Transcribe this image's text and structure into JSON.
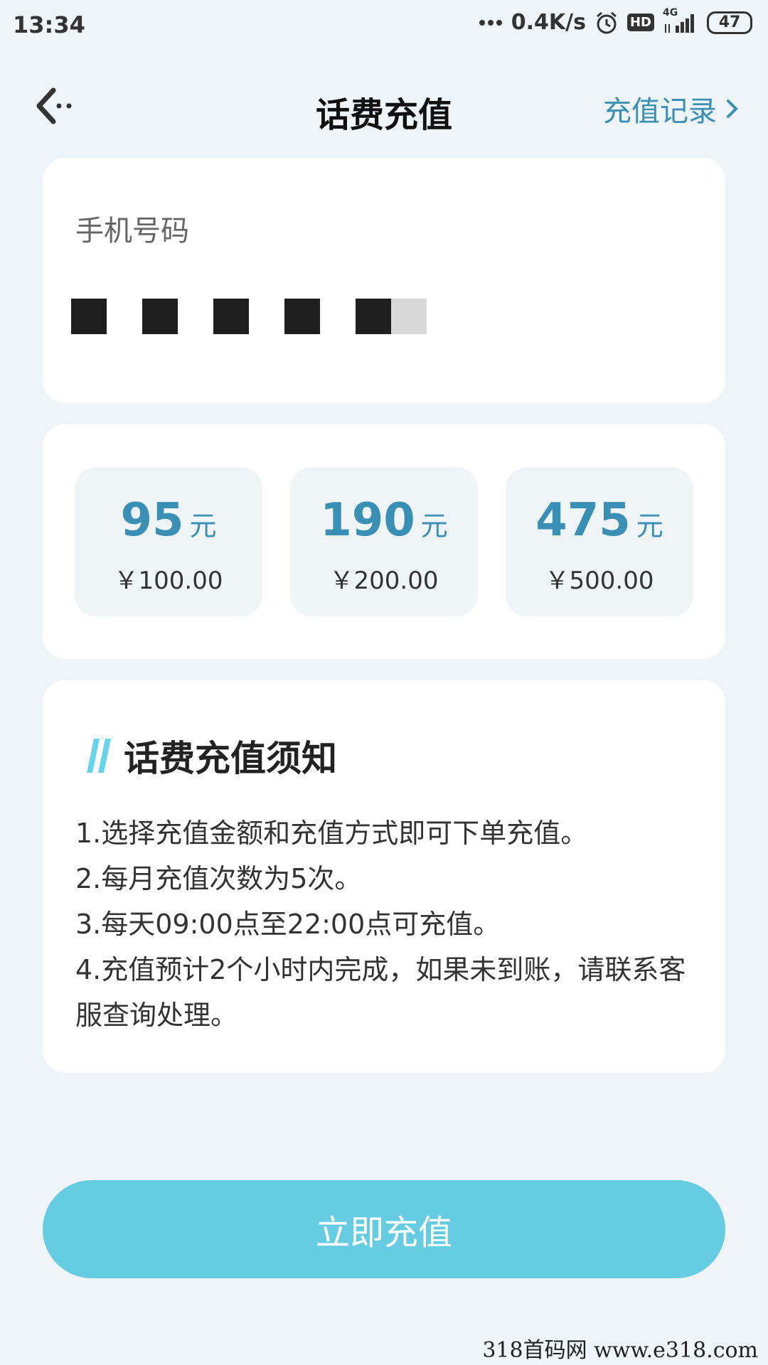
{
  "status_bar": {
    "time": "13:34",
    "network_speed": "0.4K/s",
    "hd": "HD",
    "network_type": "4G",
    "battery": "47"
  },
  "header": {
    "title": "话费充值",
    "history_link": "充值记录"
  },
  "phone": {
    "label": "手机号码"
  },
  "amounts": [
    {
      "value": "95",
      "unit": "元",
      "price": "￥100.00"
    },
    {
      "value": "190",
      "unit": "元",
      "price": "￥200.00"
    },
    {
      "value": "475",
      "unit": "元",
      "price": "￥500.00"
    }
  ],
  "notice": {
    "title": "话费充值须知",
    "items": [
      "1.选择充值金额和充值方式即可下单充值。",
      "2.每月充值次数为5次。",
      "3.每天09:00点至22:00点可充值。",
      "4.充值预计2个小时内完成，如果未到账，请联系客服查询处理。"
    ]
  },
  "submit": {
    "label": "立即充值"
  },
  "watermark": "318首码网  www.e318.com",
  "colors": {
    "accent": "#3a8fb5",
    "button": "#66cce2",
    "background": "#eef4f7",
    "card": "#ffffff"
  }
}
